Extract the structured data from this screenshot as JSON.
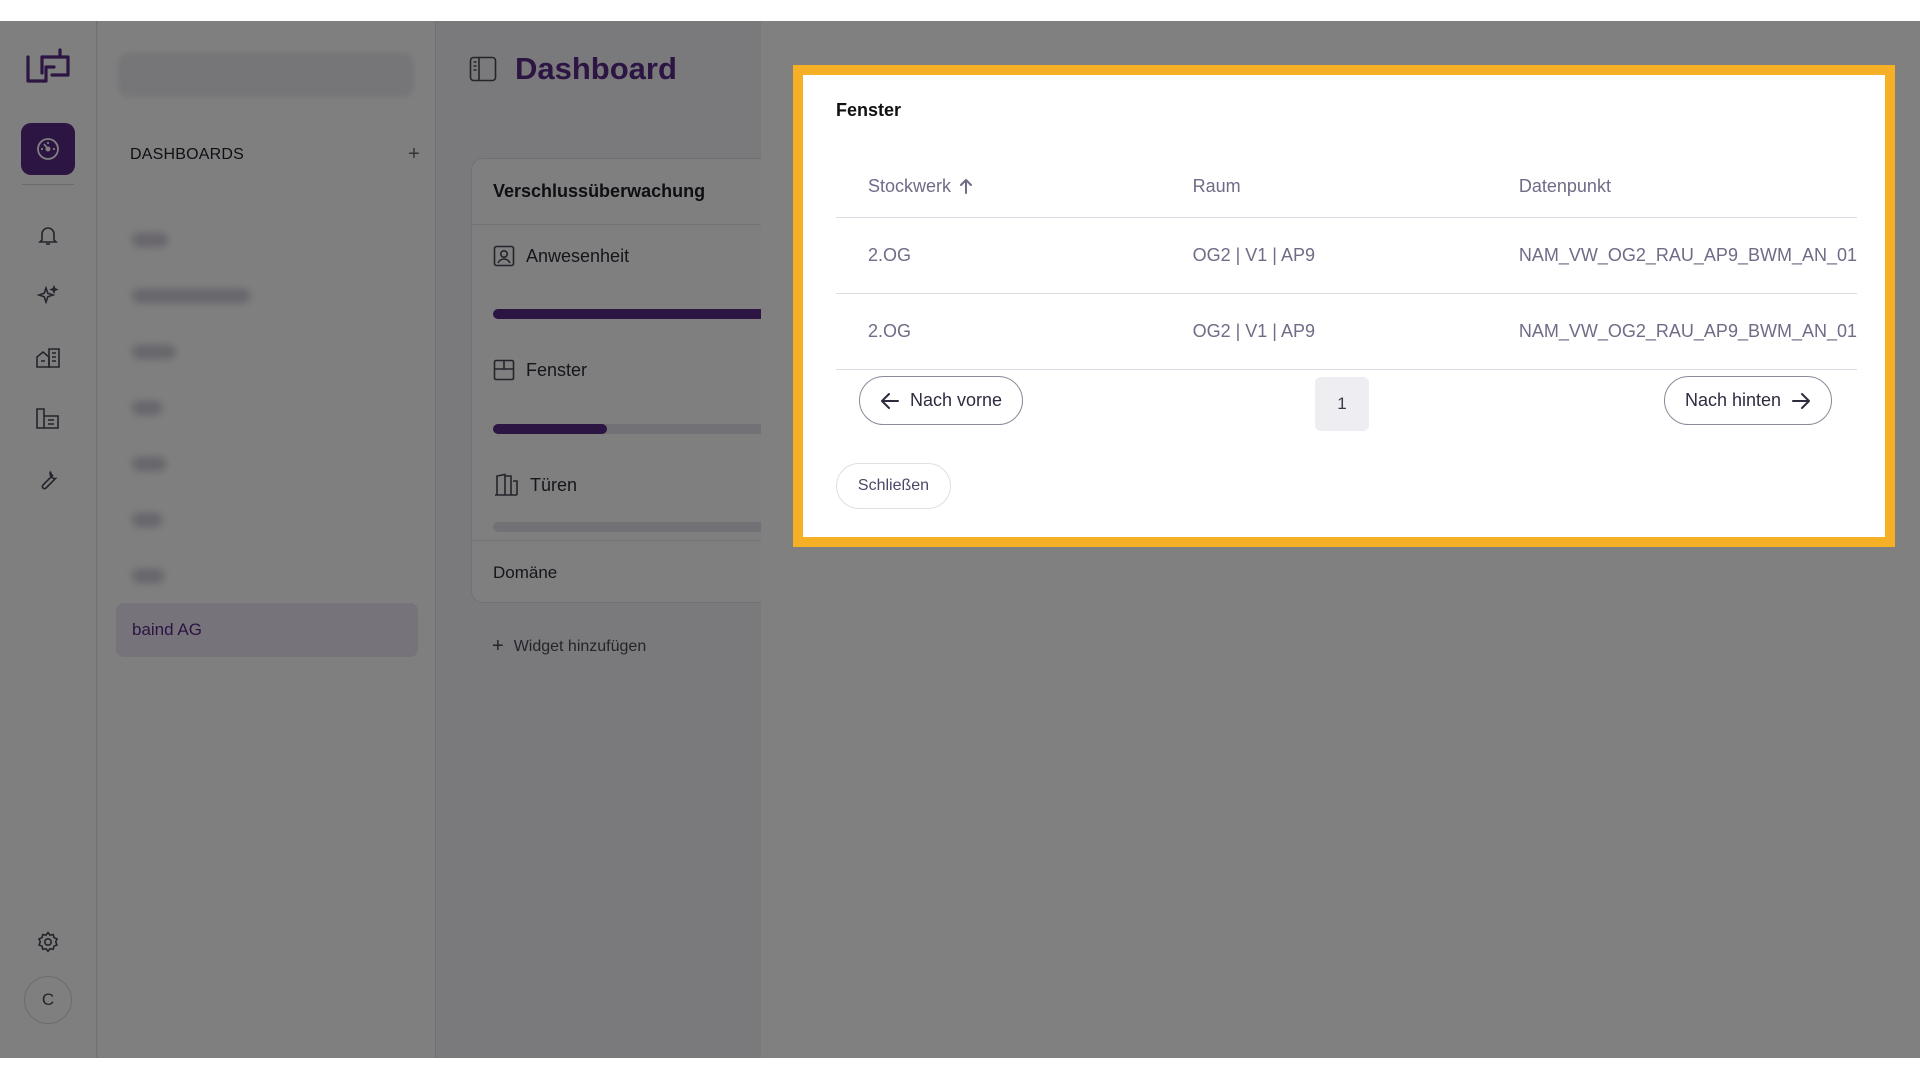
{
  "dashboard": {
    "title": "Dashboard",
    "sidebar_heading": "DASHBOARDS",
    "add_symbol": "+",
    "company": "baind AG",
    "avatar_initial": "C",
    "card": {
      "title": "Verschlussüberwachung",
      "stats": [
        {
          "label": "Anwesenheit",
          "icon": "person-frame-icon",
          "fill": 1.0
        },
        {
          "label": "Fenster",
          "icon": "window-icon",
          "fill": 0.4
        },
        {
          "label": "Türen",
          "icon": "door-icon",
          "fill": 0.0
        }
      ],
      "footer": "Domäne"
    },
    "add_widget": "Widget hinzufügen"
  },
  "modal": {
    "title": "Fenster",
    "columns": [
      "Stockwerk",
      "Raum",
      "Datenpunkt"
    ],
    "sort": {
      "column": "Stockwerk",
      "direction": "ascending"
    },
    "rows": [
      [
        "2.OG",
        "OG2 | V1 | AP9",
        "NAM_VW_OG2_RAU_AP9_BWM_AN_01"
      ],
      [
        "2.OG",
        "OG2 | V1 | AP9",
        "NAM_VW_OG2_RAU_AP9_BWM_AN_01"
      ]
    ],
    "prev_label": "Nach vorne",
    "next_label": "Nach hinten",
    "page": "1",
    "close_label": "Schließen"
  },
  "colors": {
    "brand": "#5b2a86",
    "highlight_frame": "#f6b026"
  }
}
